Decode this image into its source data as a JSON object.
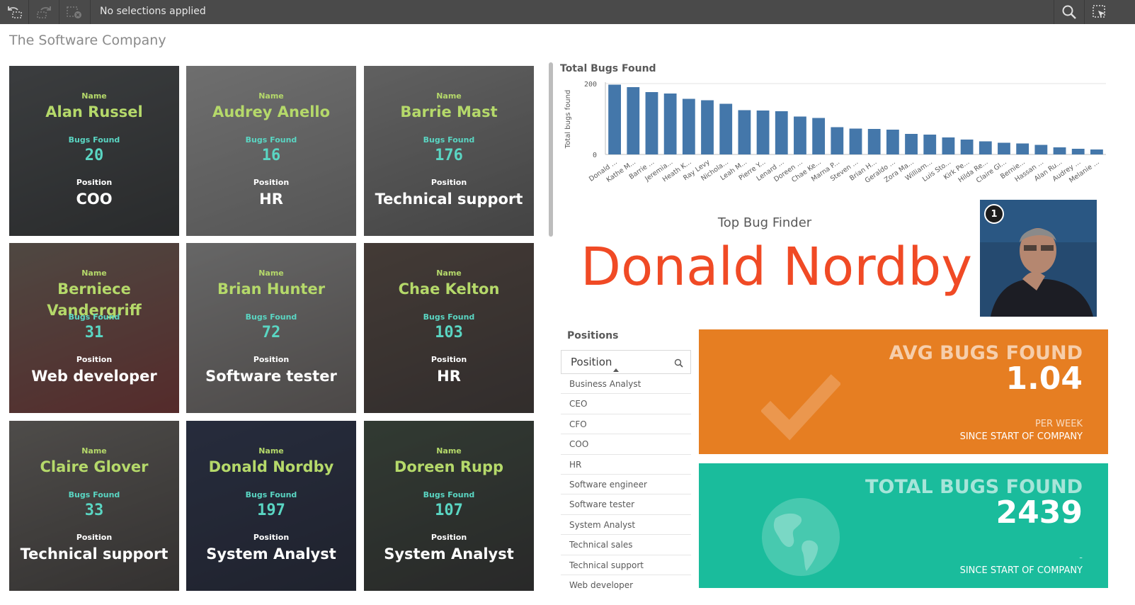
{
  "toolbar": {
    "selection_text": "No selections applied",
    "icons": [
      "selections-back-icon",
      "selections-forward-icon",
      "clear-selections-icon",
      "search-icon",
      "selections-tool-icon"
    ]
  },
  "app": {
    "title": "The Software Company"
  },
  "cards": {
    "name_label": "Name",
    "bugs_label": "Bugs Found",
    "position_label": "Position",
    "people": [
      {
        "name": "Alan Russel",
        "bugs": "20",
        "position": "COO"
      },
      {
        "name": "Audrey Anello",
        "bugs": "16",
        "position": "HR"
      },
      {
        "name": "Barrie Mast",
        "bugs": "176",
        "position": "Technical support"
      },
      {
        "name": "Berniece Vandergriff",
        "bugs": "31",
        "position": "Web developer"
      },
      {
        "name": "Brian Hunter",
        "bugs": "72",
        "position": "Software tester"
      },
      {
        "name": "Chae Kelton",
        "bugs": "103",
        "position": "HR"
      },
      {
        "name": "Claire Glover",
        "bugs": "33",
        "position": "Technical support"
      },
      {
        "name": "Donald Nordby",
        "bugs": "197",
        "position": "System Analyst"
      },
      {
        "name": "Doreen Rupp",
        "bugs": "107",
        "position": "System Analyst"
      }
    ]
  },
  "chart_data": {
    "type": "bar",
    "title": "Total Bugs Found",
    "xlabel": "",
    "ylabel": "Total bugs found",
    "ylim": [
      0,
      200
    ],
    "yticks": [
      "200",
      "0"
    ],
    "grid": true,
    "color": "#4477aa",
    "categories": [
      "Donald ...",
      "Kathe M...",
      "Barrie ...",
      "Jeremia...",
      "Heath K...",
      "Ray Levy",
      "Nichola...",
      "Leah M...",
      "Pierre Y...",
      "Lenard ...",
      "Doreen ...",
      "Chae Ke...",
      "Marna P...",
      "Steven ...",
      "Brian H...",
      "Geraldo ...",
      "Zora Ma...",
      "William...",
      "Luis Sto...",
      "Kirk Pe...",
      "Hilda Re...",
      "Claire Gl...",
      "Bernie...",
      "Hassan ...",
      "Alan Ru...",
      "Audrey ...",
      "Melanie ..."
    ],
    "values": [
      197,
      190,
      176,
      172,
      157,
      153,
      143,
      125,
      124,
      122,
      107,
      103,
      77,
      73,
      72,
      70,
      58,
      56,
      48,
      42,
      37,
      33,
      31,
      27,
      20,
      16,
      14
    ]
  },
  "top_finder": {
    "label": "Top Bug Finder",
    "name": "Donald Nordby",
    "rank": "1"
  },
  "positions": {
    "title": "Positions",
    "header": "Position",
    "items": [
      "Business Analyst",
      "CEO",
      "CFO",
      "COO",
      "HR",
      "Software engineer",
      "Software tester",
      "System Analyst",
      "Technical sales",
      "Technical support",
      "Web developer"
    ]
  },
  "kpis": {
    "avg": {
      "label": "AVG BUGS FOUND",
      "value": "1.04",
      "sub1": "PER WEEK",
      "sub2": "SINCE START OF COMPANY",
      "color": "#e67e22",
      "icon": "checkmark-icon"
    },
    "total": {
      "label": "TOTAL BUGS FOUND",
      "value": "2439",
      "sub1": "-",
      "sub2": "SINCE START OF COMPANY",
      "color": "#1abc9c",
      "icon": "globe-icon"
    }
  }
}
